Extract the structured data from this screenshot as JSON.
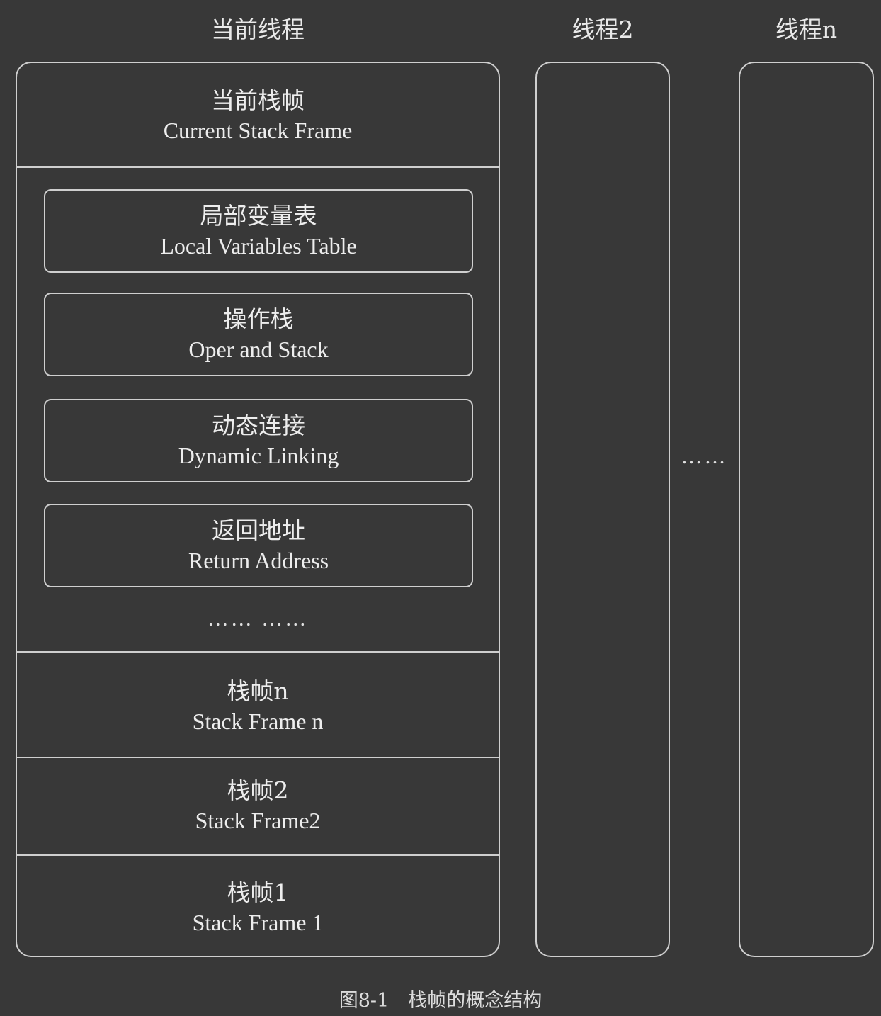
{
  "threads": {
    "current": {
      "title": "当前线程",
      "current_frame": {
        "zh": "当前栈帧",
        "en": "Current Stack Frame"
      },
      "components": [
        {
          "zh": "局部变量表",
          "en": "Local Variables Table"
        },
        {
          "zh": "操作栈",
          "en": "Oper and Stack"
        },
        {
          "zh": "动态连接",
          "en": "Dynamic Linking"
        },
        {
          "zh": "返回地址",
          "en": "Return Address"
        }
      ],
      "components_ellipsis": "…… ……",
      "frames": [
        {
          "zh": "栈帧n",
          "en": "Stack Frame n"
        },
        {
          "zh": "栈帧2",
          "en": "Stack Frame2"
        },
        {
          "zh": "栈帧1",
          "en": "Stack Frame 1"
        }
      ]
    },
    "thread2": {
      "title": "线程2"
    },
    "threadn": {
      "title": "线程n"
    },
    "between_ellipsis": "……"
  },
  "caption": "图8-1　栈帧的概念结构"
}
